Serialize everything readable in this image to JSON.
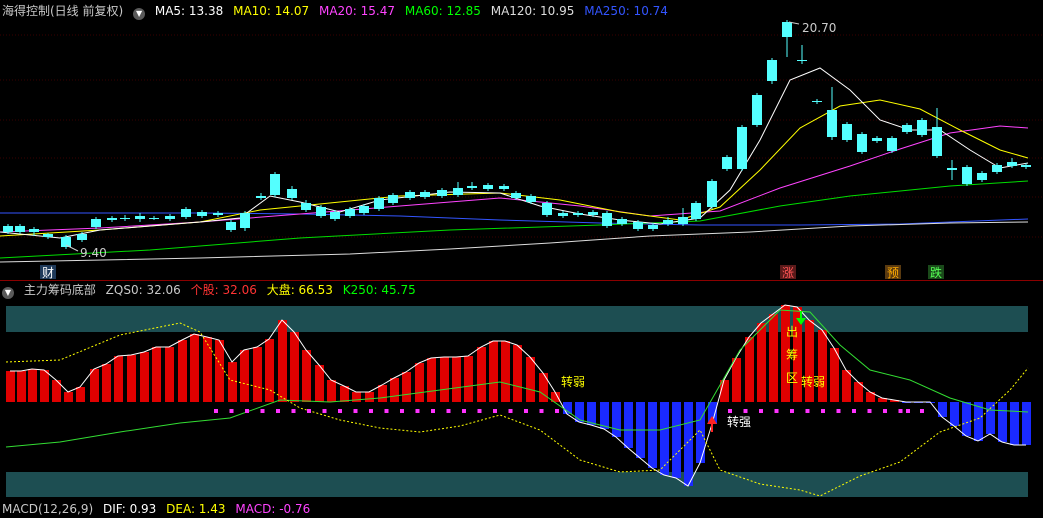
{
  "main_panel": {
    "title": "海得控制(日线 前复权)",
    "ma": [
      {
        "label": "MA5: 13.38",
        "color": "#ffffff"
      },
      {
        "label": "MA10: 14.07",
        "color": "#ffff00"
      },
      {
        "label": "MA20: 15.47",
        "color": "#ff44ff"
      },
      {
        "label": "MA60: 12.85",
        "color": "#00ff00"
      },
      {
        "label": "MA120: 10.95",
        "color": "#dddddd"
      },
      {
        "label": "MA250: 10.74",
        "color": "#3355ff"
      }
    ],
    "high_label": "20.70",
    "low_label": "9.40",
    "markers": [
      {
        "text": "财",
        "bg": "#1f3a5a",
        "color": "#ffffff"
      },
      {
        "text": "涨",
        "bg": "#5a1a1a",
        "color": "#ff5555"
      },
      {
        "text": "预",
        "bg": "#5a3a10",
        "color": "#ffaa00"
      },
      {
        "text": "跌",
        "bg": "#1a4a1a",
        "color": "#55ff55"
      }
    ]
  },
  "indicator_panel": {
    "title": "主力筹码底部",
    "zqs0": "ZQS0: 32.06",
    "gegu": "个股: 32.06",
    "dapan": "大盘: 66.53",
    "k250": "K250: 45.75",
    "annotations": {
      "weak1": "转弱",
      "weak2": "转弱",
      "strong": "转强",
      "out": "出",
      "chip": "筹",
      "zone": "区"
    }
  },
  "macd_panel": {
    "title": "MACD(12,26,9)",
    "dif": "DIF: 0.93",
    "dea": "DEA: 1.43",
    "macd": "MACD: -0.76"
  }
}
